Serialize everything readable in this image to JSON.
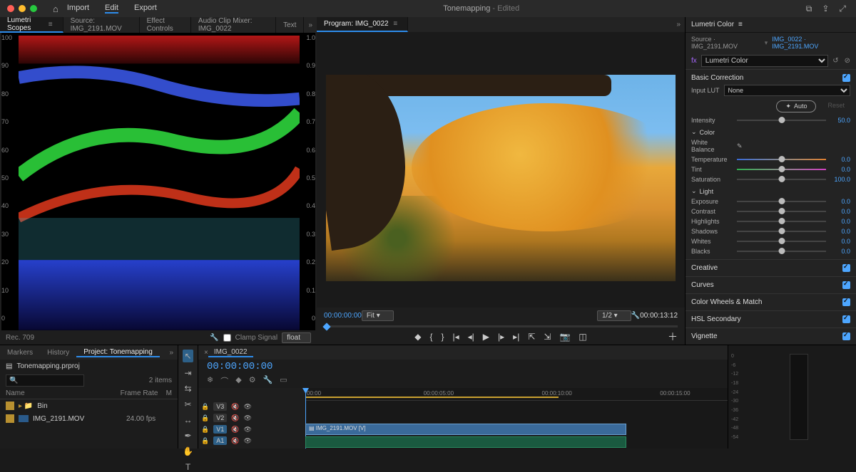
{
  "titlebar": {
    "menu": [
      "Import",
      "Edit",
      "Export"
    ],
    "menu_active": 1,
    "title": "Tonemapping",
    "title_suffix": " - Edited"
  },
  "left_panel": {
    "tabs": [
      "Lumetri Scopes",
      "Source: IMG_2191.MOV",
      "Effect Controls",
      "Audio Clip Mixer: IMG_0022",
      "Text"
    ],
    "active_tab": 0,
    "axis_left": [
      "100",
      "90",
      "80",
      "70",
      "60",
      "50",
      "40",
      "30",
      "20",
      "10",
      "0"
    ],
    "axis_right": [
      "1.0",
      "0.9",
      "0.8",
      "0.7",
      "0.6",
      "0.5",
      "0.4",
      "0.3",
      "0.2",
      "0.1",
      "0"
    ],
    "footer_left": "Rec. 709",
    "clamp_label": "Clamp Signal",
    "float_label": "float"
  },
  "program": {
    "tab": "Program: IMG_0022",
    "timecode": "00:00:00:00",
    "fit": "Fit",
    "ratio": "1/2",
    "duration": "00:00:13:12"
  },
  "lumetri": {
    "title": "Lumetri Color",
    "source_label": "Source · IMG_2191.MOV",
    "link": "IMG_0022 · IMG_2191.MOV",
    "fx_name": "Lumetri Color",
    "basic": "Basic Correction",
    "lut_label": "Input LUT",
    "lut_value": "None",
    "auto": "Auto",
    "reset": "Reset",
    "intensity_label": "Intensity",
    "intensity_val": "50.0",
    "color_head": "Color",
    "wb_label": "White Balance",
    "params_color": [
      {
        "lbl": "Temperature",
        "val": "0.0",
        "cls": "temp"
      },
      {
        "lbl": "Tint",
        "val": "0.0",
        "cls": "tint"
      },
      {
        "lbl": "Saturation",
        "val": "100.0",
        "cls": ""
      }
    ],
    "light_head": "Light",
    "params_light": [
      {
        "lbl": "Exposure",
        "val": "0.0"
      },
      {
        "lbl": "Contrast",
        "val": "0.0"
      },
      {
        "lbl": "Highlights",
        "val": "0.0"
      },
      {
        "lbl": "Shadows",
        "val": "0.0"
      },
      {
        "lbl": "Whites",
        "val": "0.0"
      },
      {
        "lbl": "Blacks",
        "val": "0.0"
      }
    ],
    "collapsed": [
      "Creative",
      "Curves",
      "Color Wheels & Match",
      "HSL Secondary",
      "Vignette"
    ]
  },
  "project": {
    "tabs": [
      "Markers",
      "History",
      "Project: Tonemapping"
    ],
    "active": 2,
    "file": "Tonemapping.prproj",
    "items_count": "2 items",
    "cols": [
      "Name",
      "Frame Rate",
      "M"
    ],
    "rows": [
      {
        "icon": "folder",
        "name": "Bin",
        "fps": ""
      },
      {
        "icon": "clip",
        "name": "IMG_2191.MOV",
        "fps": "24.00 fps"
      }
    ]
  },
  "timeline": {
    "tab": "IMG_0022",
    "timecode": "00:00:00:00",
    "ruler": [
      "00:00",
      "00:00:05:00",
      "00:00:10:00",
      "00:00:15:00"
    ],
    "tracks": [
      {
        "id": "V3"
      },
      {
        "id": "V2"
      },
      {
        "id": "V1",
        "on": true
      },
      {
        "id": "A1",
        "on": true
      }
    ],
    "clip_name": "IMG_2191.MOV [V]"
  },
  "meter_labels": [
    "0",
    "-6",
    "-12",
    "-18",
    "-24",
    "-30",
    "-36",
    "-42",
    "-48",
    "-54"
  ]
}
